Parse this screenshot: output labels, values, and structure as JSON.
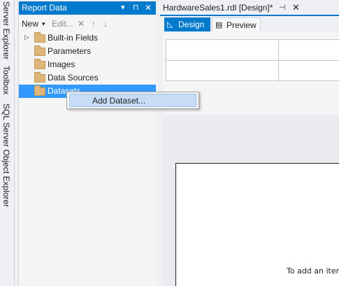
{
  "left_strip": {
    "tabs": [
      "Server Explorer",
      "Toolbox",
      "SQL Server Object Explorer"
    ]
  },
  "report_data": {
    "title": "Report Data",
    "dropdown_glyph": "▾",
    "pin_glyph": "⊓",
    "close_glyph": "✕",
    "toolbar": {
      "new_label": "New",
      "new_caret": "▾",
      "edit_label": "Edit...",
      "delete_glyph": "✕",
      "up_glyph": "↑",
      "down_glyph": "↓"
    },
    "tree": [
      {
        "label": "Built-in Fields",
        "expander": "▷"
      },
      {
        "label": "Parameters"
      },
      {
        "label": "Images"
      },
      {
        "label": "Data Sources"
      },
      {
        "label": "Datasets",
        "selected": true
      }
    ]
  },
  "context_menu": {
    "items": [
      "Add Dataset..."
    ]
  },
  "document": {
    "tab_title": "HardwareSales1.rdl [Design]*",
    "pin_glyph": "⊣",
    "close_glyph": "✕",
    "design_label": "Design",
    "preview_label": "Preview",
    "design_icon": "📐",
    "preview_icon": "🗟",
    "canvas_hint": "To add an item"
  },
  "colors": {
    "accent": "#007acc",
    "selection": "#3399ff",
    "menu_highlight": "#c7ddf5",
    "folder": "#dcb67a"
  }
}
